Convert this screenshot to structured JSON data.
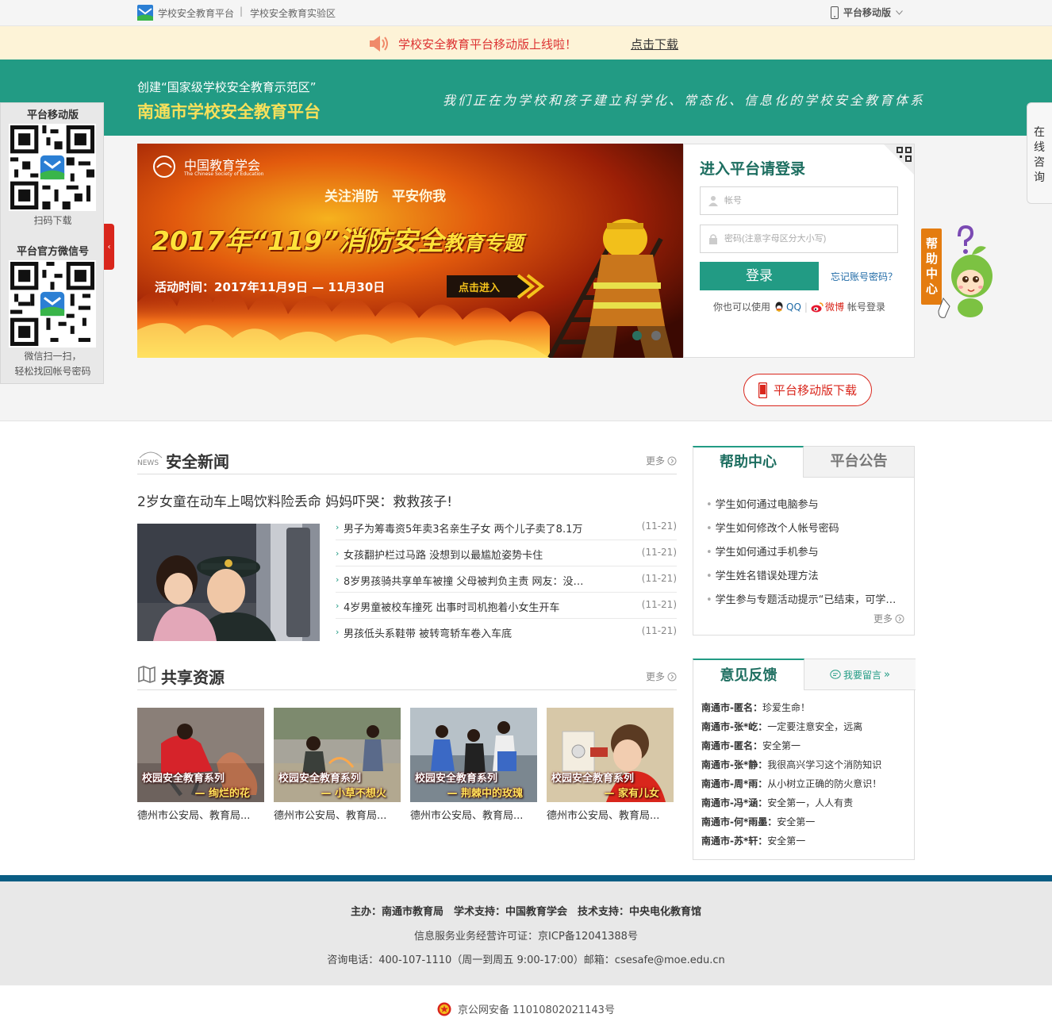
{
  "topbar": {
    "site_name": "学校安全教育平台",
    "separator": "|",
    "experiment_zone": "学校安全教育实验区",
    "mobile_label": "平台移动版"
  },
  "notice": {
    "message": "学校安全教育平台移动版上线啦！",
    "download_link": "点击下载"
  },
  "header": {
    "subtitle": "创建“国家级学校安全教育示范区”",
    "title": "南通市学校安全教育平台",
    "slogan": "我们正在为学校和孩子建立科学化、常态化、信息化的学校安全教育体系"
  },
  "qr_panel": {
    "mobile_title": "平台移动版",
    "mobile_caption": "扫码下载",
    "wechat_title": "平台官方微信号",
    "wechat_caption_1": "微信扫一扫，",
    "wechat_caption_2": "轻松找回帐号密码",
    "collapse_arrow": "‹"
  },
  "banner": {
    "org_cn": "中国教育学会",
    "org_en": "The Chinese Society of Education",
    "tagline": "关注消防　平安你我",
    "headline": "2017年“119”消防安全",
    "headline_small": "教育专题",
    "activity_time": "活动时间：2017年11月9日 — 11月30日",
    "enter_button": "点击进入"
  },
  "login": {
    "heading": "进入平台请登录",
    "account_placeholder": "帐号",
    "password_placeholder": "密码(注意字母区分大小写)",
    "login_button": "登录",
    "forgot_link": "忘记账号密码？",
    "other_prefix": "你也可以使用",
    "qq": "QQ",
    "weibo": "微博",
    "other_suffix": "帐号登录",
    "divider": "|"
  },
  "mobile_download_button": "平台移动版下载",
  "consult_tab": "在线咨询",
  "help_float": "帮助中心",
  "news": {
    "title": "安全新闻",
    "more": "更多",
    "lead_headline": "2岁女童在动车上喝饮料险丢命 妈妈吓哭：救救孩子!",
    "items": [
      {
        "title": "男子为筹毒资5年卖3名亲生子女 两个儿子卖了8.1万",
        "date": "(11-21)"
      },
      {
        "title": "女孩翻护栏过马路 没想到以最尴尬姿势卡住",
        "date": "(11-21)"
      },
      {
        "title": "8岁男孩骑共享单车被撞 父母被判负主责 网友：没…",
        "date": "(11-21)"
      },
      {
        "title": "4岁男童被校车撞死 出事时司机抱着小女生开车",
        "date": "(11-21)"
      },
      {
        "title": "男孩低头系鞋带 被转弯轿车卷入车底",
        "date": "(11-21)"
      }
    ]
  },
  "resources": {
    "title": "共享资源",
    "more": "更多",
    "items": [
      {
        "series": "校园安全教育系列",
        "name": "— 绚烂的花",
        "caption": "德州市公安局、教育局..."
      },
      {
        "series": "校园安全教育系列",
        "name": "— 小草不想火",
        "caption": "德州市公安局、教育局..."
      },
      {
        "series": "校园安全教育系列",
        "name": "— 荆棘中的玫瑰",
        "caption": "德州市公安局、教育局..."
      },
      {
        "series": "校园安全教育系列",
        "name": "— 家有儿女",
        "caption": "德州市公安局、教育局..."
      }
    ]
  },
  "help_center": {
    "tab_active": "帮助中心",
    "tab_inactive": "平台公告",
    "items": [
      "学生如何通过电脑参与",
      "学生如何修改个人帐号密码",
      "学生如何通过手机参与",
      "学生姓名错误处理方法",
      "学生参与专题活动提示“已结束，可学…"
    ],
    "more": "更多"
  },
  "feedback": {
    "tab": "意见反馈",
    "leave_message": "我要留言",
    "items": [
      {
        "user": "南通市-匿名：",
        "text": "珍爱生命！"
      },
      {
        "user": "南通市-张*屹：",
        "text": "一定要注意安全，远离"
      },
      {
        "user": "南通市-匿名：",
        "text": "安全第一"
      },
      {
        "user": "南通市-张*静：",
        "text": "我很高兴学习这个消防知识"
      },
      {
        "user": "南通市-周*雨：",
        "text": "从小树立正确的防火意识！"
      },
      {
        "user": "南通市-冯*涵：",
        "text": "安全第一，人人有责"
      },
      {
        "user": "南通市-何*雨墨：",
        "text": "安全第一"
      },
      {
        "user": "南通市-苏*轩：",
        "text": "安全第一"
      }
    ]
  },
  "footer": {
    "sponsors": "主办：南通市教育局　学术支持：中国教育学会　技术支持：中央电化教育馆",
    "license": "信息服务业务经营许可证：京ICP备12041388号",
    "contact": "咨询电话：400-107-1110（周一到周五 9:00-17:00）邮箱：csesafe@moe.edu.cn",
    "police": "京公网安备 11010802021143号"
  },
  "colors": {
    "brand_green": "#229b84",
    "accent_red": "#d9261c",
    "title_yellow": "#f8e05a",
    "footer_blue": "#0a5d84"
  }
}
